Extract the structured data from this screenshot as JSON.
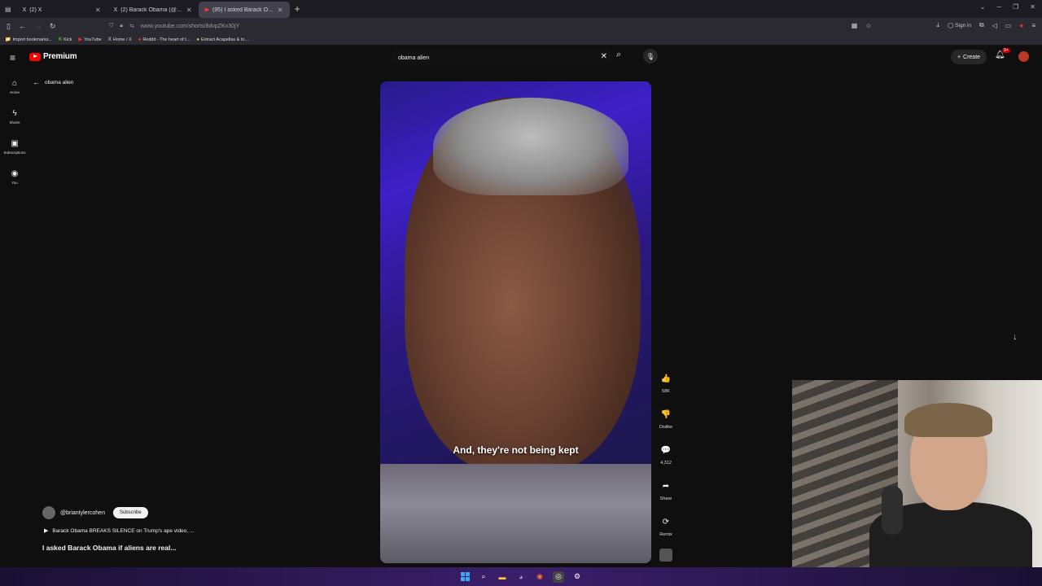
{
  "browser": {
    "tabs": [
      {
        "icon": "X",
        "title": "(2) X",
        "active": false
      },
      {
        "icon": "X",
        "title": "(2) Barack Obama (@BarackOb...",
        "active": false
      },
      {
        "icon": "▶",
        "title": "(95) I asked Barack Obama...",
        "active": true
      }
    ],
    "url": "www.youtube.com/shorts/8dvpZKv30jY",
    "signin_label": "Sign in",
    "bookmarks": [
      {
        "icon": "📁",
        "label": "Import bookmarks..."
      },
      {
        "icon": "K",
        "label": "Kick"
      },
      {
        "icon": "▶",
        "label": "YouTube"
      },
      {
        "icon": "X",
        "label": "Home / X"
      },
      {
        "icon": "●",
        "label": "Reddit - The heart of t..."
      },
      {
        "icon": "●",
        "label": "Extract Acapellas & In..."
      }
    ]
  },
  "youtube": {
    "logo_text": "Premium",
    "search_value": "obama alien",
    "create_label": "Create",
    "notification_count": "9+",
    "sidebar": [
      {
        "icon": "⌂",
        "label": "Home"
      },
      {
        "icon": "ϟ",
        "label": "Shorts"
      },
      {
        "icon": "▣",
        "label": "Subscriptions"
      },
      {
        "icon": "◉",
        "label": "You"
      }
    ],
    "back_query": "obama alien"
  },
  "short": {
    "caption": "And, they're not being kept",
    "actions": [
      {
        "name": "like",
        "icon": "👍",
        "label": "58K"
      },
      {
        "name": "dislike",
        "icon": "👎",
        "label": "Dislike"
      },
      {
        "name": "comments",
        "icon": "💬",
        "label": "4,312"
      },
      {
        "name": "share",
        "icon": "➦",
        "label": "Share"
      },
      {
        "name": "remix",
        "icon": "⟳",
        "label": "Remix"
      }
    ],
    "channel": "@briantylercohen",
    "subscribe_label": "Subscribe",
    "related_video": "Barack Obama BREAKS SILENCE on Trump's ape video, ...",
    "title": "I asked Barack Obama if aliens are real..."
  }
}
